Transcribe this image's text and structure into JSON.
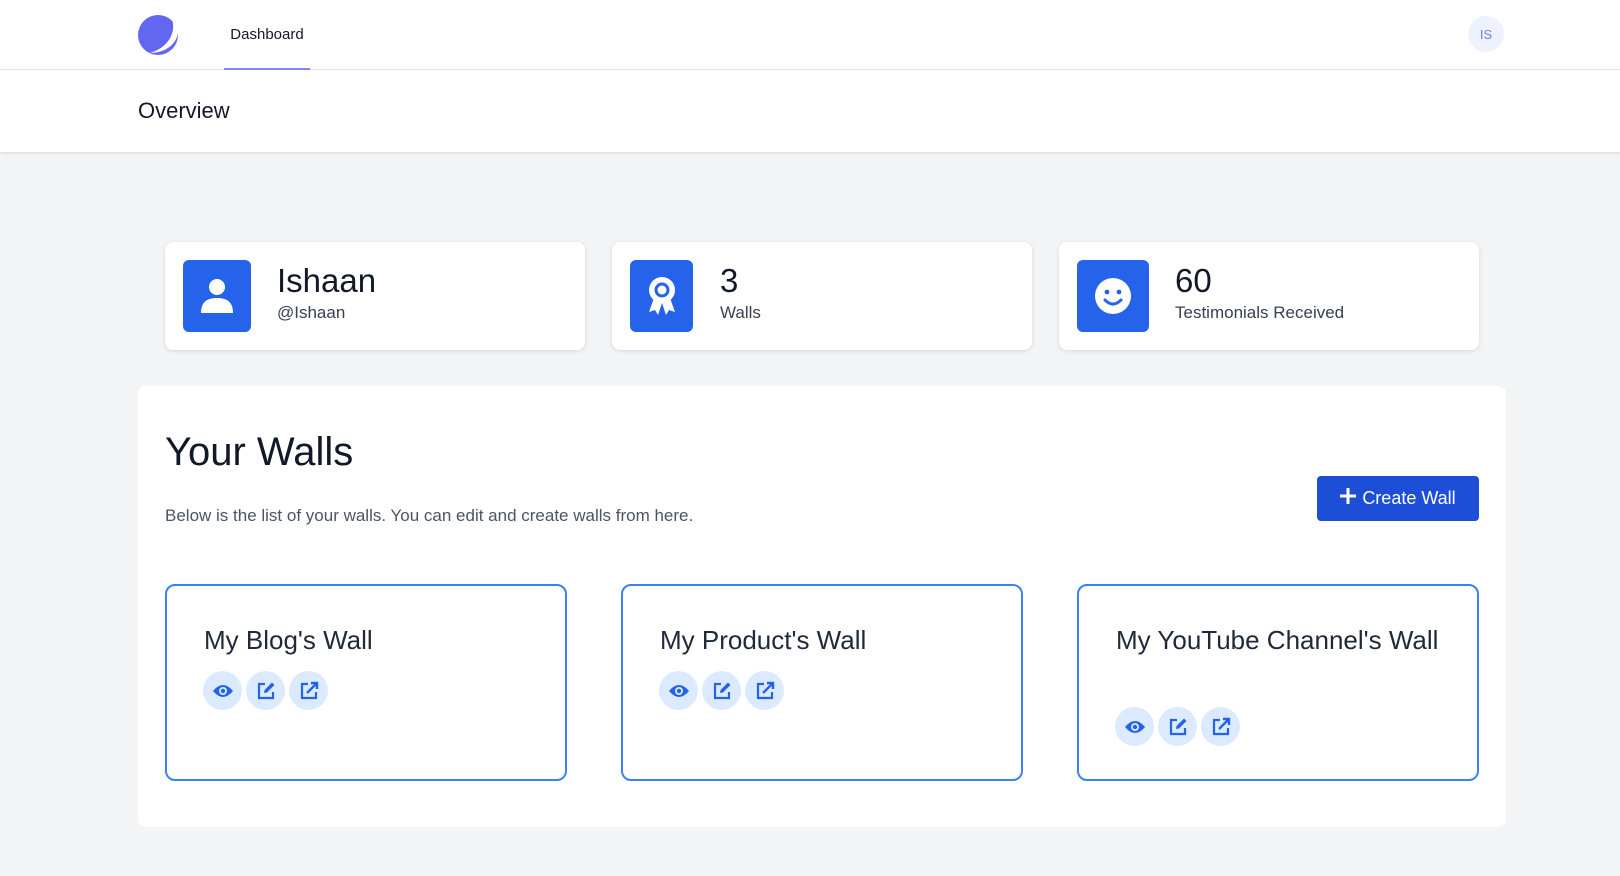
{
  "nav": {
    "logo_icon": "moon-logo-icon",
    "tabs": [
      {
        "label": "Dashboard",
        "active": true
      }
    ],
    "avatar_initials": "IS"
  },
  "header": {
    "title": "Overview"
  },
  "stats": [
    {
      "icon": "user-icon",
      "value": "Ishaan",
      "label": "@Ishaan"
    },
    {
      "icon": "award-icon",
      "value": "3",
      "label": "Walls"
    },
    {
      "icon": "smile-icon",
      "value": "60",
      "label": "Testimonials Received"
    }
  ],
  "walls": {
    "title": "Your Walls",
    "description": "Below is the list of your walls. You can edit and create walls from here.",
    "create_button": "Create Wall",
    "items": [
      {
        "name": "My Blog's Wall",
        "actions": [
          "eye-icon",
          "edit-icon",
          "external-link-icon"
        ]
      },
      {
        "name": "My Product's Wall",
        "actions": [
          "eye-icon",
          "edit-icon",
          "external-link-icon"
        ]
      },
      {
        "name": "My YouTube Channel's Wall",
        "actions": [
          "eye-icon",
          "edit-icon",
          "external-link-icon"
        ]
      }
    ]
  },
  "colors": {
    "primary": "#2563eb",
    "button": "#1d4ed8",
    "card_border": "#3b82f6",
    "action_bg": "#dbeafe",
    "tab_underline": "#818cf8",
    "logo": "#6366f1"
  }
}
